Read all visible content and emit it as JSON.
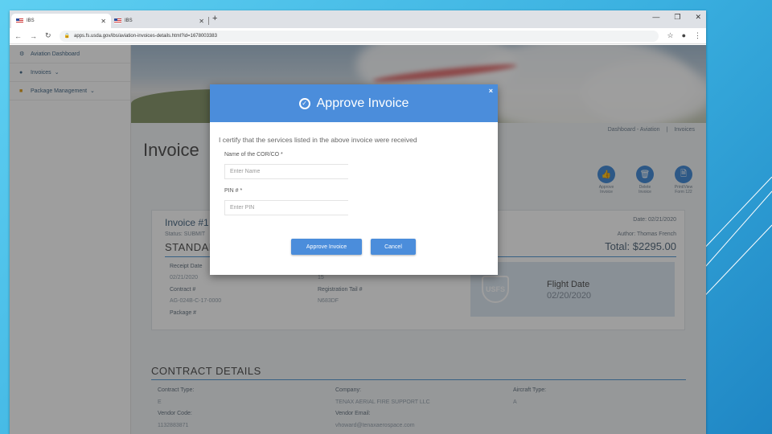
{
  "browser": {
    "tabs": [
      {
        "label": "IBS",
        "active": true
      },
      {
        "label": "IBS",
        "active": false
      }
    ],
    "url": "apps.fs.usda.gov/ibs/aviation-invoices-details.html?id=1678003383"
  },
  "sidebar": {
    "items": [
      {
        "label": "Aviation Dashboard",
        "icon": "dashboard-icon"
      },
      {
        "label": "Invoices",
        "icon": "invoice-icon"
      },
      {
        "label": "Package Management",
        "icon": "package-icon"
      }
    ]
  },
  "breadcrumb": {
    "first": "Dashboard - Aviation",
    "sep": "|",
    "second": "Invoices"
  },
  "page_title": "Invoice",
  "actions": [
    {
      "label": "Approve Invoice",
      "icon": "thumbs-up-icon"
    },
    {
      "label": "Delete Invoice",
      "icon": "trash-icon"
    },
    {
      "label": "Print/View Form 122",
      "icon": "document-icon"
    }
  ],
  "invoice": {
    "number": "Invoice #1",
    "status": "Status: SUBMIT",
    "type": "STANDAR",
    "date": "Date: 02/21/2020",
    "author": "Author: Thomas French",
    "total": "Total: $2295.00",
    "receipt_date_label": "Receipt Date",
    "receipt_date": "02/21/2020",
    "contract_label": "Contract #",
    "contract": "AG-024B-C-17-0000",
    "package_label": "Package #",
    "mid_value": "15",
    "tail_label": "Registration Tail #",
    "tail": "N683DF",
    "flight_title": "Flight Date",
    "flight_date": "02/20/2020",
    "badge": "USFS"
  },
  "contract_details": {
    "title": "CONTRACT DETAILS",
    "type_label": "Contract Type:",
    "type": "E",
    "vendor_code_label": "Vendor Code:",
    "vendor_code": "1132883871",
    "company_label": "Company:",
    "company": "TENAX AERIAL FIRE SUPPORT LLC",
    "vendor_email_label": "Vendor Email:",
    "vendor_email": "vhoward@tenaxaerospace.com",
    "aircraft_label": "Aircraft Type:",
    "aircraft": "A"
  },
  "modal": {
    "title": "Approve Invoice",
    "close": "×",
    "certify": "I certify that the services listed in the above invoice were received",
    "name_label": "Name of the COR/CO *",
    "name_placeholder": "Enter Name",
    "pin_label": "PIN # *",
    "pin_placeholder": "Enter PIN",
    "approve_button": "Approve Invoice",
    "cancel_button": "Cancel"
  },
  "colors": {
    "accent": "#4b8ddb",
    "slide_bg": "#3ab0e0"
  }
}
